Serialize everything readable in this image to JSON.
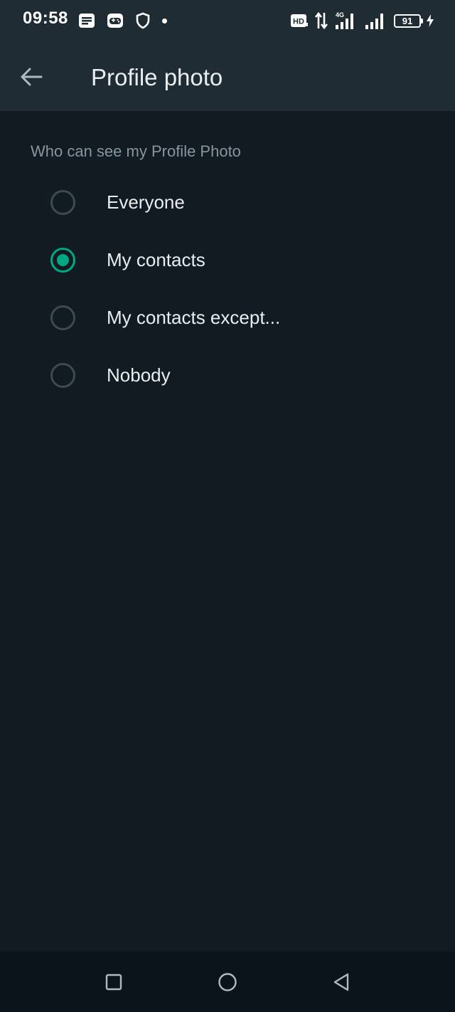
{
  "status_bar": {
    "time": "09:58",
    "battery_level": "91",
    "network_type": "4G",
    "hd_label": "HD"
  },
  "app_bar": {
    "title": "Profile photo"
  },
  "section": {
    "label": "Who can see my Profile Photo"
  },
  "options": [
    {
      "label": "Everyone",
      "selected": false
    },
    {
      "label": "My contacts",
      "selected": true
    },
    {
      "label": "My contacts except...",
      "selected": false
    },
    {
      "label": "Nobody",
      "selected": false
    }
  ],
  "colors": {
    "header": "#1f2c34",
    "background": "#121b22",
    "accent": "#00a884",
    "secondary_text": "#8696a0",
    "primary_text": "#e9edef"
  }
}
